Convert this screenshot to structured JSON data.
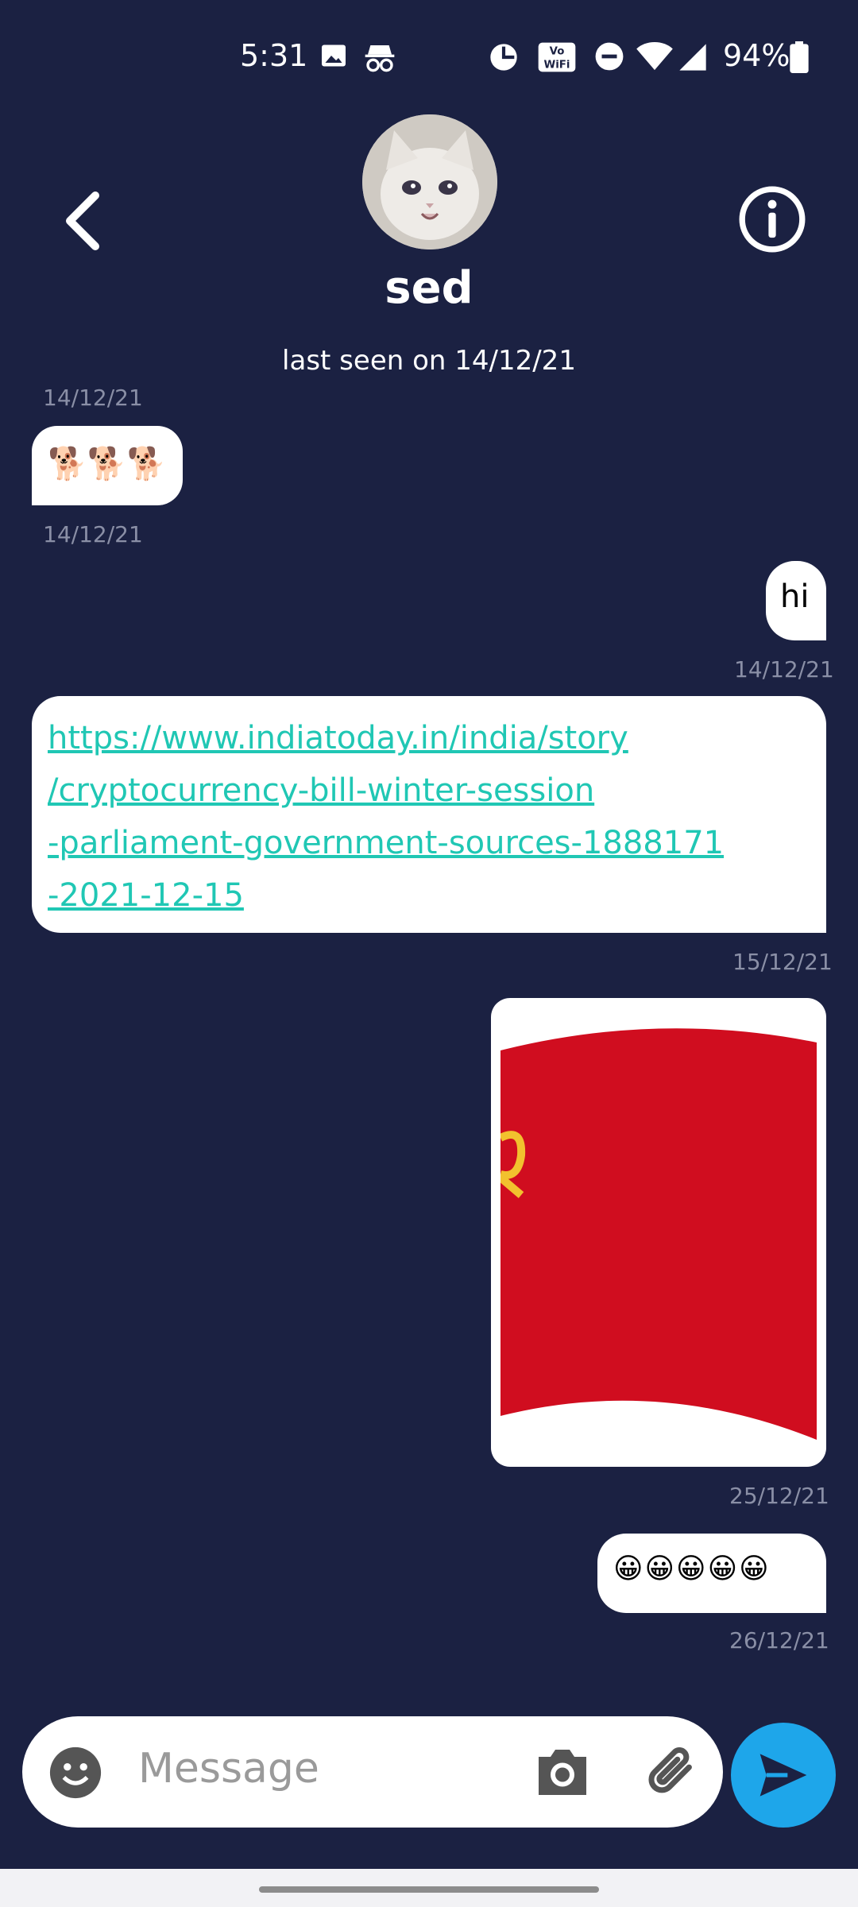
{
  "status_bar": {
    "time": "5:31",
    "battery": "94%",
    "icons": [
      "image-icon",
      "incognito-icon",
      "data-saver-icon",
      "vowifi-icon",
      "dnd-icon",
      "wifi-icon",
      "signal-icon",
      "battery-icon"
    ]
  },
  "header": {
    "contact_name": "sed",
    "last_seen": "last seen on 14/12/21"
  },
  "messages": [
    {
      "partial_timestamp": "14/12/21"
    },
    {
      "side": "left",
      "content": "🐕🐕🐕",
      "timestamp": "14/12/21"
    },
    {
      "side": "right",
      "content": "hi",
      "timestamp": "14/12/21"
    },
    {
      "side": "left",
      "type": "link",
      "lines": [
        "https://www.indiatoday.in/india/story",
        "/cryptocurrency-bill-winter-session",
        "-parliament-government-sources-1888171",
        "-2021-12-15"
      ],
      "timestamp": "15/12/21"
    },
    {
      "side": "right",
      "type": "image",
      "timestamp": "25/12/21"
    },
    {
      "side": "right",
      "content": "😀😀😀😀😀",
      "timestamp": "26/12/21"
    }
  ],
  "composer": {
    "placeholder": "Message"
  },
  "colors": {
    "background": "#1b2142",
    "link": "#20c7b4",
    "send_button": "#1ea6ea",
    "flag_red": "#d00d1f"
  }
}
